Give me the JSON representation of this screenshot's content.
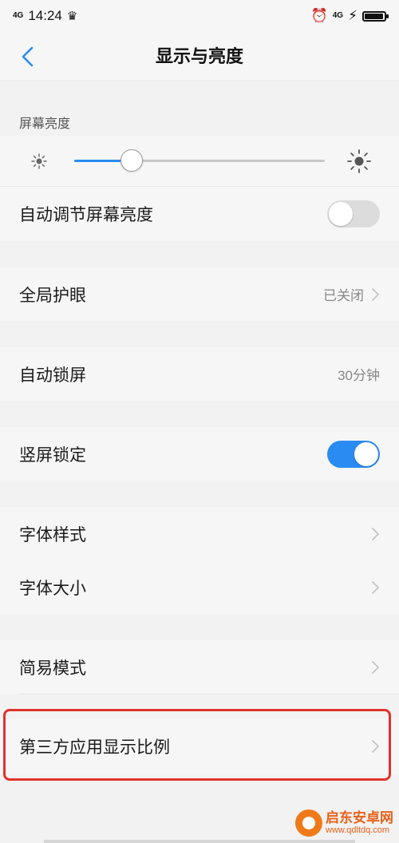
{
  "status_bar": {
    "network": "4G",
    "time": "14:24",
    "crown_icon": "crown-icon",
    "right_network": "4G",
    "battery_level": 0.95
  },
  "header": {
    "title": "显示与亮度",
    "back_icon": "chevron-left-icon"
  },
  "brightness": {
    "section_label": "屏幕亮度",
    "level": 0.23,
    "auto_label": "自动调节屏幕亮度",
    "auto_enabled": false
  },
  "eye_care": {
    "label": "全局护眼",
    "value": "已关闭"
  },
  "auto_lock": {
    "label": "自动锁屏",
    "value": "30分钟"
  },
  "portrait_lock": {
    "label": "竖屏锁定",
    "enabled": true
  },
  "font_style": {
    "label": "字体样式"
  },
  "font_size": {
    "label": "字体大小"
  },
  "easy_mode": {
    "label": "简易模式"
  },
  "third_party_ratio": {
    "label": "第三方应用显示比例"
  },
  "watermark": {
    "title": "启东安卓网",
    "url": "www.qdltdq.com"
  },
  "colors": {
    "accent": "#2a8bf2",
    "highlight": "#e0332b",
    "background": "#f2f2f2"
  }
}
